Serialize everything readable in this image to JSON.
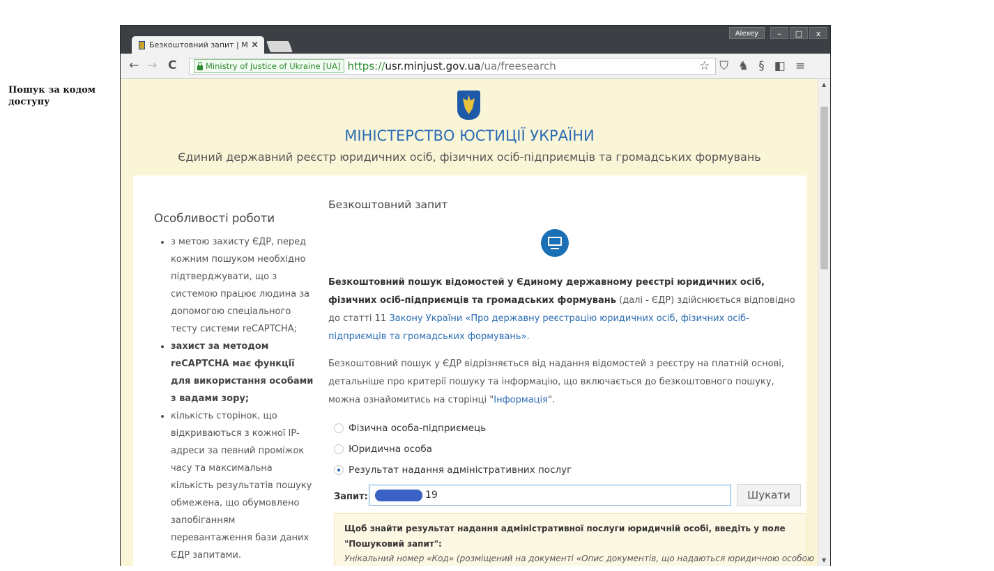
{
  "caption": "Пошук за кодом доступу",
  "browser": {
    "tab_title": "Безкоштовний запит | Мі",
    "tab_close": "×",
    "profile": "Alexey",
    "win_min": "–",
    "win_max": "□",
    "win_close": "x",
    "back": "←",
    "forward": "→",
    "reload": "C",
    "ev_label": "Ministry of Justice of Ukraine [UA]",
    "url_scheme": "https://",
    "url_host": "usr.minjust.gov.ua",
    "url_path": "/ua/freesearch",
    "star": "☆",
    "menu": "≡"
  },
  "header": {
    "title": "МІНІСТЕРСТВО ЮСТИЦІЇ УКРАЇНИ",
    "subtitle": "Єдиний державний реєстр юридичних осіб, фізичних осіб-підприємців та громадських формувань"
  },
  "sidebar": {
    "title": "Особливості роботи",
    "items": [
      "з метою захисту ЄДР, перед кожним пошуком необхідно підтверджувати, що з системою працює людина за допомогою спеціального тесту системи reCAPTCHA;",
      "захист за методом reCAPTCHA має функції для використання особами з вадами зору;",
      "кількість сторінок, що відкриваються з кожної IP-адреси за певний проміжок часу та максимальна кількість результатів пошуку обмежена, що обумовлено запобіганням перевантаження бази даних ЄДР запитами."
    ]
  },
  "main": {
    "heading": "Безкоштовний запит",
    "p1_bold": "Безкоштовний пошук відомостей у Єдиному державному реєстрі юридичних осіб, фізичних осіб-підприємців та громадських формувань",
    "p1_text": " (далі - ЄДР) здійснюється відповідно до статті 11 ",
    "p1_link": "Закону України «Про державну реєстрацію юридичних осіб, фізичних осіб-підприємців та громадських формувань».",
    "p2_text": "Безкоштовний пошук у ЄДР відрізняється від надання відомостей з реєстру на платній основі, детальніше про критерії пошуку та інформацію, що включається до безкоштовного пошуку, можна ознайомитись на сторінці \"",
    "p2_link": "Інформація",
    "p2_end": "\".",
    "radio_options": [
      {
        "label": "Фізична особа-підприємець",
        "checked": false
      },
      {
        "label": "Юридична особа",
        "checked": false
      },
      {
        "label": "Результат надання адміністративних послуг",
        "checked": true
      }
    ],
    "query_label": "Запит:",
    "query_value": "19",
    "search_button": "Шукати",
    "notice_bold": "Щоб знайти результат надання адміністративної послуги юридичній особі, введіть у поле \"Пошуковий запит\":",
    "notice_italic": "Унікальний номер «Код» (розміщений на документі «Опис документів, що надаються юридичною особою"
  },
  "colors": {
    "accent": "#2a6cb3",
    "page_bg": "#fbf5d7",
    "notice_bg": "#fcf8e3"
  }
}
